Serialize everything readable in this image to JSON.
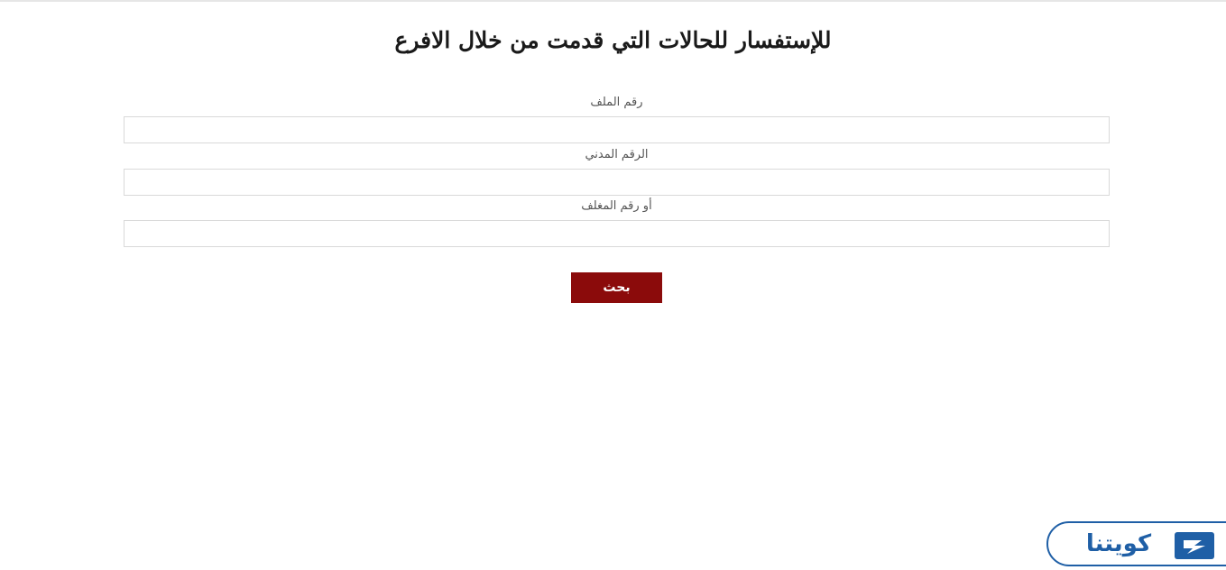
{
  "page": {
    "title": "للإستفسار للحالات التي قدمت من خلال الافرع"
  },
  "form": {
    "file_number_label": "رقم الملف",
    "file_number_value": "",
    "civil_id_label": "الرقم المدني",
    "civil_id_value": "",
    "envelope_number_label": "أو رقم المغلف",
    "envelope_number_value": "",
    "search_button_label": "بحث"
  },
  "watermark": {
    "logo_text": "كويتنا",
    "icon": "bolt-icon"
  },
  "colors": {
    "button_background": "#8b0b0b",
    "brand_blue": "#1f5fa6",
    "input_border": "#d9d9d9"
  }
}
